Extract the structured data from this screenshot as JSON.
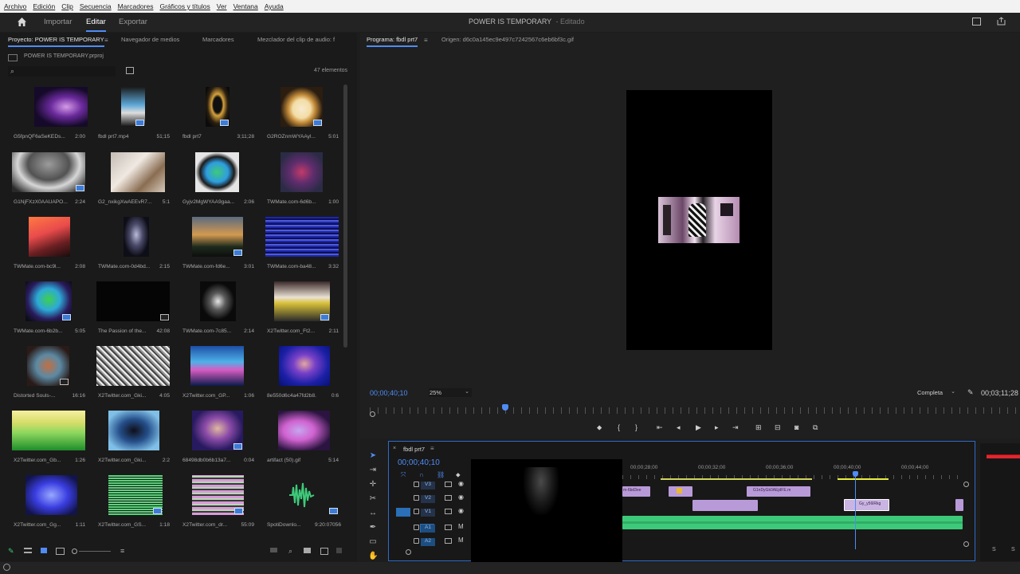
{
  "menu": [
    "Archivo",
    "Edición",
    "Clip",
    "Secuencia",
    "Marcadores",
    "Gráficos y títulos",
    "Ver",
    "Ventana",
    "Ayuda"
  ],
  "header": {
    "tabs": [
      "Importar",
      "Editar",
      "Exportar"
    ],
    "project_title": "POWER IS TEMPORARY",
    "project_state": "- Editado"
  },
  "project_panel": {
    "tabs": [
      "Proyecto: POWER IS TEMPORARY",
      "Navegador de medios",
      "Marcadores",
      "Mezclador del clip de audio: f"
    ],
    "file": "POWER IS TEMPORARY.prproj",
    "count": "47 elementos",
    "search_placeholder": "",
    "items": [
      {
        "name": "G5fpnQF6aSeKEDs...",
        "dur": "2:00"
      },
      {
        "name": "fbdl prt7.mp4",
        "dur": "51;15"
      },
      {
        "name": "fbdl prt7",
        "dur": "3;11;28"
      },
      {
        "name": "G2ROZnmWYAAyl...",
        "dur": "5:01"
      },
      {
        "name": "G1NjFXzX0AAUAPO...",
        "dur": "2:24"
      },
      {
        "name": "G2_nxikgXwAEEvR7...",
        "dur": "5:1"
      },
      {
        "name": "Gyjv2MgWYAA9gaa...",
        "dur": "2:06"
      },
      {
        "name": "TWMate.com-6d6b...",
        "dur": "1:00"
      },
      {
        "name": "TWMate.com-bc9l...",
        "dur": "2:08"
      },
      {
        "name": "TWMate.com-0d4bd...",
        "dur": "2:15"
      },
      {
        "name": "TWMate.com-fd6e...",
        "dur": "3:01"
      },
      {
        "name": "TWMate.com-ba48...",
        "dur": "3:32"
      },
      {
        "name": "TWMate.com-6b2b...",
        "dur": "5:05"
      },
      {
        "name": "The Passion of the...",
        "dur": "42:08"
      },
      {
        "name": "TWMate.com-7c85...",
        "dur": "2:14"
      },
      {
        "name": "X2Twitter.com_Ft2...",
        "dur": "2:11"
      },
      {
        "name": "Distorted Souls-...",
        "dur": "16:16"
      },
      {
        "name": "X2Twitter.com_Gki...",
        "dur": "4:05"
      },
      {
        "name": "X2Twitter.com_GP...",
        "dur": "1:06"
      },
      {
        "name": "8e550d6c4a47fd2b8...",
        "dur": "0:6"
      },
      {
        "name": "X2Twitter.com_Gb...",
        "dur": "1:26"
      },
      {
        "name": "X2Twitter.com_Gki...",
        "dur": "2:2"
      },
      {
        "name": "68498db0b6b13a7...",
        "dur": "0:04"
      },
      {
        "name": "artifact (50).gif",
        "dur": "5:14"
      },
      {
        "name": "X2Twitter.com_Gg...",
        "dur": "1:11"
      },
      {
        "name": "X2Twitter.com_GS...",
        "dur": "1:18"
      },
      {
        "name": "X2Twitter.com_dr...",
        "dur": "55:09"
      },
      {
        "name": "SpotiDownlo...",
        "dur": "9:20:07056"
      }
    ]
  },
  "program_monitor": {
    "tab": "Programa: fbdl prt7",
    "source_tab": "Origen: d6c0a145ec9e497c7242567c6eb6bf3c.gif",
    "timecode": "00;00;40;10",
    "zoom": "25%",
    "quality": "Completa",
    "duration": "00;03;11;28"
  },
  "timeline": {
    "sequence": "fbdl prt7",
    "timecode": "00;00;40;10",
    "ticks": [
      "00;00;28;00",
      "00;00;32;00",
      "00;00;36;00",
      "00;00;40;00",
      "00;00;44;00"
    ],
    "tracks": [
      "V3",
      "V2",
      "V1",
      "A1",
      "A2"
    ],
    "clip_labels": [
      "G1nDyGk0AEjdFE.m",
      "Gy_y56lRkg",
      "m-6bd3ee"
    ]
  },
  "colors": {
    "accent": "#4f8cf5",
    "clip_video": "#b99ad8",
    "clip_audio": "#3ec97a"
  }
}
